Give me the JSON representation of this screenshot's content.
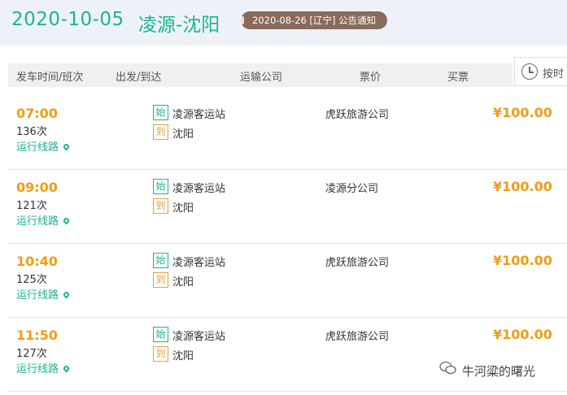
{
  "header": {
    "date": "2020-10-05",
    "route": "凌源-沈阳",
    "notice": "2020-08-26 [辽宁] 公告通知"
  },
  "table": {
    "columns": [
      "发车时间/班次",
      "出发/到达",
      "运输公司",
      "票价",
      "买票"
    ],
    "sort_label": "按时"
  },
  "rows": [
    {
      "time": "07:00",
      "bus": "136次",
      "line": "运行线路",
      "start_tag": "始",
      "from": "凌源客运站",
      "end_tag": "到",
      "to": "沈阳",
      "company": "虎跃旅游公司",
      "price": "¥100.00"
    },
    {
      "time": "09:00",
      "bus": "121次",
      "line": "运行线路",
      "start_tag": "始",
      "from": "凌源客运站",
      "end_tag": "到",
      "to": "沈阳",
      "company": "凌源分公司",
      "price": "¥100.00"
    },
    {
      "time": "10:40",
      "bus": "125次",
      "line": "运行线路",
      "start_tag": "始",
      "from": "凌源客运站",
      "end_tag": "到",
      "to": "沈阳",
      "company": "虎跃旅游公司",
      "price": "¥100.00"
    },
    {
      "time": "11:50",
      "bus": "127次",
      "line": "运行线路",
      "start_tag": "始",
      "from": "凌源客运站",
      "end_tag": "到",
      "to": "沈阳",
      "company": "虎跃旅游公司",
      "price": "¥100.00"
    }
  ],
  "watermark": "牛河粱的曙光"
}
